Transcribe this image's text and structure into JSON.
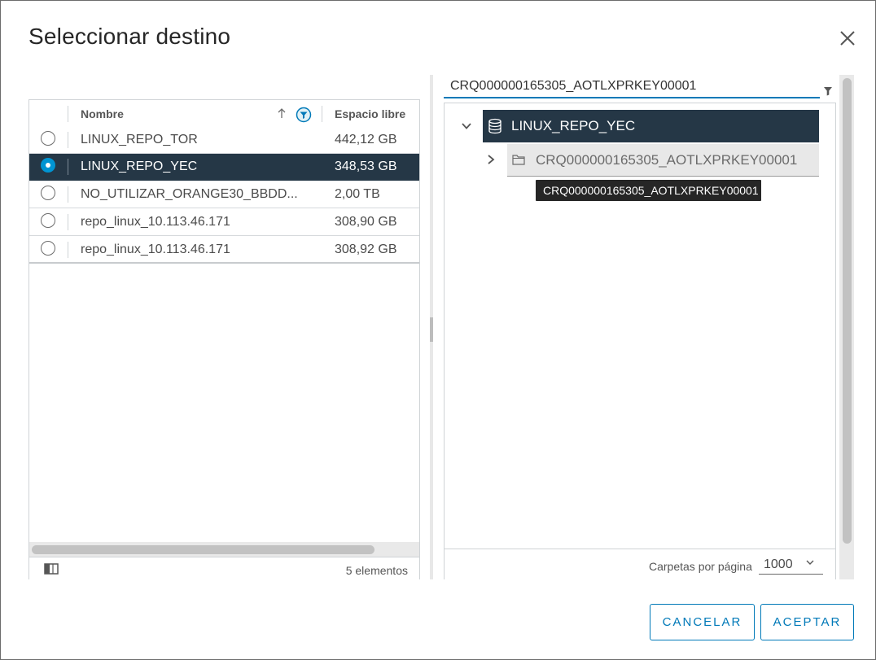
{
  "dialog": {
    "title": "Seleccionar destino",
    "close_icon": "close-icon"
  },
  "grid": {
    "columns": [
      "Nombre",
      "Espacio libre"
    ],
    "sort_icon": "arrow-up-icon",
    "filter_icon": "filter-active-icon",
    "rows": [
      {
        "name": "LINUX_REPO_TOR",
        "free": "442,12 GB",
        "selected": false
      },
      {
        "name": "LINUX_REPO_YEC",
        "free": "348,53 GB",
        "selected": true
      },
      {
        "name": "NO_UTILIZAR_ORANGE30_BBDD...",
        "free": "2,00 TB",
        "selected": false
      },
      {
        "name": "repo_linux_10.113.46.171",
        "free": "308,90 GB",
        "selected": false
      },
      {
        "name": "repo_linux_10.113.46.171",
        "free": "308,92 GB",
        "selected": false
      }
    ],
    "footer": {
      "column_toggle_icon": "column-toggle-icon",
      "count": "5 elementos"
    }
  },
  "tree": {
    "search_value": "CRQ000000165305_AOTLXPRKEY00001",
    "filter_icon": "filter-icon",
    "root": {
      "label": "LINUX_REPO_YEC",
      "icon": "datastore-icon",
      "expanded": true
    },
    "child": {
      "label": "CRQ000000165305_AOTLXPRKEY00001",
      "icon": "folder-icon",
      "expanded": false
    },
    "tooltip": "CRQ000000165305_AOTLXPRKEY00001",
    "footer": {
      "per_page_label": "Carpetas por página",
      "per_page_value": "1000"
    }
  },
  "buttons": {
    "cancel": "CANCELAR",
    "accept": "ACEPTAR"
  },
  "colors": {
    "selected_row": "#253746",
    "accent": "#0079b8",
    "radio_selected": "#0094d2"
  }
}
